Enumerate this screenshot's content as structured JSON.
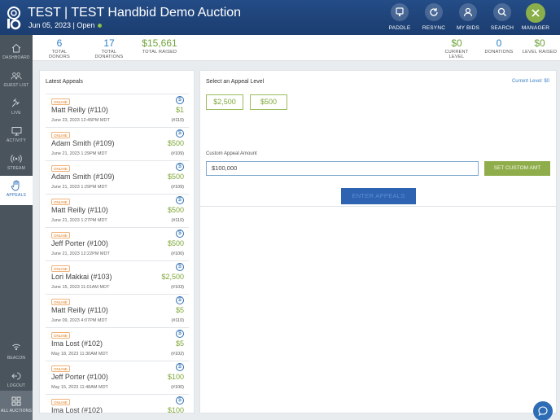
{
  "header": {
    "title": "TEST | TEST Handbid Demo Auction",
    "subtitle": "Jun 05, 2023 | Open",
    "buttons": [
      {
        "label": "PADDLE",
        "icon": "paddle-icon"
      },
      {
        "label": "RESYNC",
        "icon": "resync-icon"
      },
      {
        "label": "MY BIDS",
        "icon": "user-icon"
      },
      {
        "label": "SEARCH",
        "icon": "search-icon"
      },
      {
        "label": "MANAGER",
        "icon": "close-icon"
      }
    ]
  },
  "sidebar": {
    "items": [
      {
        "label": "DASHBOARD",
        "icon": "home-icon"
      },
      {
        "label": "GUEST LIST",
        "icon": "guests-icon"
      },
      {
        "label": "LIVE",
        "icon": "gavel-icon"
      },
      {
        "label": "ACTIVITY",
        "icon": "monitor-icon"
      },
      {
        "label": "STREAM",
        "icon": "stream-icon"
      },
      {
        "label": "APPEALS",
        "icon": "hand-icon"
      }
    ],
    "bottom_items": [
      {
        "label": "BEACON",
        "icon": "beacon-icon"
      },
      {
        "label": "LOGOUT",
        "icon": "logout-icon"
      },
      {
        "label": "ALL AUCTIONS",
        "icon": "grid-icon"
      }
    ]
  },
  "stats": {
    "left": [
      {
        "value": "6",
        "label": "TOTAL DONORS"
      },
      {
        "value": "17",
        "label": "TOTAL DONATIONS"
      },
      {
        "value": "$15,661",
        "label": "TOTAL RAISED"
      }
    ],
    "right": [
      {
        "value": "$0",
        "label": "CURRENT LEVEL"
      },
      {
        "value": "0",
        "label": "DONATIONS"
      },
      {
        "value": "$0",
        "label": "LEVEL RAISED"
      }
    ]
  },
  "appeals": {
    "title": "Latest Appeals",
    "badge": "ONLINE",
    "coin": "$",
    "rows": [
      {
        "name": "Matt Reilly  (#110)",
        "date": "June 23, 2023 12:45PM MDT",
        "amount": "$1",
        "paddle": "(#110)"
      },
      {
        "name": "Adam Smith  (#109)",
        "date": "June 21, 2023 1:29PM MDT",
        "amount": "$500",
        "paddle": "(#109)"
      },
      {
        "name": "Adam Smith  (#109)",
        "date": "June 21, 2023 1:29PM MDT",
        "amount": "$500",
        "paddle": "(#109)"
      },
      {
        "name": "Matt Reilly  (#110)",
        "date": "June 21, 2023 1:27PM MDT",
        "amount": "$500",
        "paddle": "(#110)"
      },
      {
        "name": "Jeff Porter  (#100)",
        "date": "June 21, 2023 12:22PM MDT",
        "amount": "$500",
        "paddle": "(#100)"
      },
      {
        "name": "Lori  Makkai  (#103)",
        "date": "June 15, 2023 11:01AM MDT",
        "amount": "$2,500",
        "paddle": "(#103)"
      },
      {
        "name": "Matt Reilly  (#110)",
        "date": "June 09, 2023 4:07PM MDT",
        "amount": "$5",
        "paddle": "(#110)"
      },
      {
        "name": "Ima Lost  (#102)",
        "date": "May 18, 2023 11:30AM MDT",
        "amount": "$5",
        "paddle": "(#102)"
      },
      {
        "name": "Jeff Porter  (#100)",
        "date": "May 15, 2023 11:48AM MDT",
        "amount": "$100",
        "paddle": "(#100)"
      },
      {
        "name": "Ima Lost  (#102)",
        "date": "",
        "amount": "$100",
        "paddle": ""
      }
    ]
  },
  "appeal_level": {
    "title": "Select an Appeal Level",
    "current_level": "Current Level: $0",
    "levels": [
      "$2,500",
      "$500"
    ],
    "custom_label": "Custom Appeal Amount",
    "custom_value": "$100,000",
    "set_custom_label": "SET CUSTOM AMT",
    "enter_label": "ENTER APPEALS"
  },
  "colors": {
    "header": "#1f4579",
    "accent_green": "#8fae4b",
    "accent_blue": "#2f80c5",
    "sidebar": "#4a545c"
  }
}
